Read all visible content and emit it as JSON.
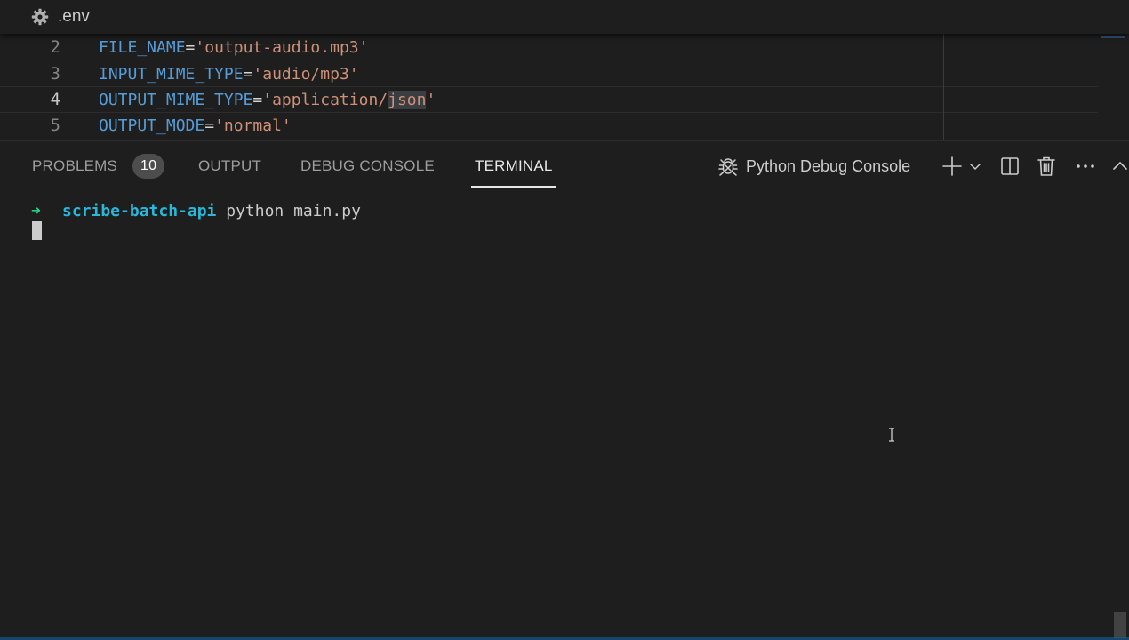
{
  "editor": {
    "file_name": ".env",
    "lines": [
      {
        "number": "2",
        "key": "FILE_NAME",
        "op": "=",
        "value": "'output-audio.mp3'"
      },
      {
        "number": "3",
        "key": "INPUT_MIME_TYPE",
        "op": "=",
        "value": "'audio/mp3'"
      },
      {
        "number": "4",
        "key": "OUTPUT_MIME_TYPE",
        "op": "=",
        "value_pre": "'application/",
        "value_hl": "json",
        "value_post": "'"
      },
      {
        "number": "5",
        "key": "OUTPUT_MODE",
        "op": "=",
        "value": "'normal'"
      }
    ]
  },
  "panel": {
    "tabs": {
      "problems": "PROBLEMS",
      "problems_count": "10",
      "output": "OUTPUT",
      "debug_console": "DEBUG CONSOLE",
      "terminal": "TERMINAL"
    },
    "active_tab": "TERMINAL",
    "terminal_name": "Python Debug Console"
  },
  "terminal": {
    "prompt_arrow": "➜",
    "directory": "scribe-batch-api",
    "command": " python main.py"
  },
  "icons": {
    "file": "gear-icon",
    "terminal_type": "bug-icon",
    "new": "plus-icon",
    "dropdown": "chevron-down-icon",
    "split": "split-icon",
    "kill": "trash-icon",
    "more": "ellipsis-icon",
    "maximize": "chevron-up-icon"
  },
  "colors": {
    "background": "#1e1e1e",
    "key": "#569cd6",
    "string": "#ce9178",
    "prompt_arrow": "#23d18b",
    "directory": "#29b8db"
  }
}
